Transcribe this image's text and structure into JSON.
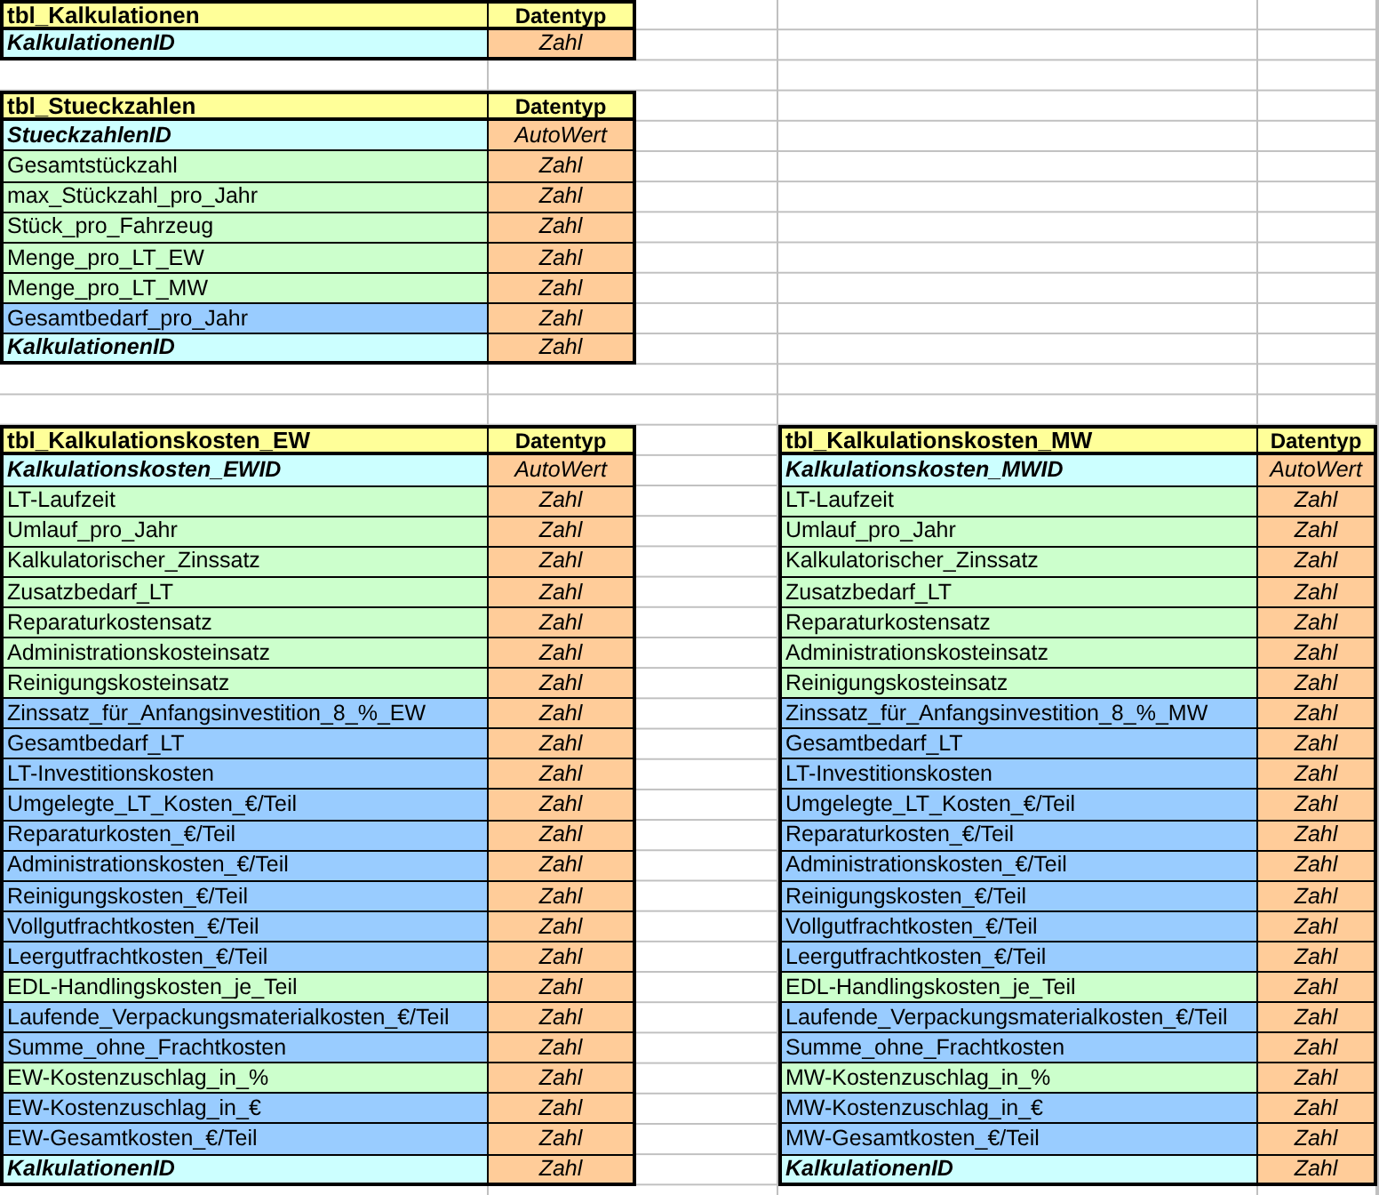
{
  "sheet": {
    "top_tables": [
      {
        "title": "tbl_Kalkulationen",
        "type_header": "Datentyp",
        "fields": [
          {
            "name": "KalkulationenID",
            "type": "Zahl",
            "kind": "key",
            "color": "#ccffff"
          }
        ]
      },
      {
        "title": "tbl_Stueckzahlen",
        "type_header": "Datentyp",
        "fields": [
          {
            "name": "StueckzahlenID",
            "type": "AutoWert",
            "kind": "key",
            "color": "#ccffff"
          },
          {
            "name": "Gesamtstückzahl",
            "type": "Zahl",
            "kind": "field",
            "color": "#ccffcc"
          },
          {
            "name": "max_Stückzahl_pro_Jahr",
            "type": "Zahl",
            "kind": "field",
            "color": "#ccffcc"
          },
          {
            "name": "Stück_pro_Fahrzeug",
            "type": "Zahl",
            "kind": "field",
            "color": "#ccffcc"
          },
          {
            "name": "Menge_pro_LT_EW",
            "type": "Zahl",
            "kind": "field",
            "color": "#ccffcc"
          },
          {
            "name": "Menge_pro_LT_MW",
            "type": "Zahl",
            "kind": "field",
            "color": "#ccffcc"
          },
          {
            "name": "Gesamtbedarf_pro_Jahr",
            "type": "Zahl",
            "kind": "field",
            "color": "#99ccff"
          },
          {
            "name": "KalkulationenID",
            "type": "Zahl",
            "kind": "key",
            "color": "#ccffff"
          }
        ]
      }
    ],
    "bottom_tables": [
      {
        "title": "tbl_Kalkulationskosten_EW",
        "type_header": "Datentyp",
        "fields": [
          {
            "name": "Kalkulationskosten_EWID",
            "type": "AutoWert",
            "kind": "key",
            "color": "#ccffff"
          },
          {
            "name": "LT-Laufzeit",
            "type": "Zahl",
            "kind": "field",
            "color": "#ccffcc"
          },
          {
            "name": "Umlauf_pro_Jahr",
            "type": "Zahl",
            "kind": "field",
            "color": "#ccffcc"
          },
          {
            "name": "Kalkulatorischer_Zinssatz",
            "type": "Zahl",
            "kind": "field",
            "color": "#ccffcc"
          },
          {
            "name": "Zusatzbedarf_LT",
            "type": "Zahl",
            "kind": "field",
            "color": "#ccffcc"
          },
          {
            "name": "Reparaturkostensatz",
            "type": "Zahl",
            "kind": "field",
            "color": "#ccffcc"
          },
          {
            "name": "Administrationskosteinsatz",
            "type": "Zahl",
            "kind": "field",
            "color": "#ccffcc"
          },
          {
            "name": "Reinigungskosteinsatz",
            "type": "Zahl",
            "kind": "field",
            "color": "#ccffcc"
          },
          {
            "name": "Zinssatz_für_Anfangsinvestition_8_%_EW",
            "type": "Zahl",
            "kind": "field",
            "color": "#99ccff"
          },
          {
            "name": "Gesamtbedarf_LT",
            "type": "Zahl",
            "kind": "field",
            "color": "#99ccff"
          },
          {
            "name": "LT-Investitionskosten",
            "type": "Zahl",
            "kind": "field",
            "color": "#99ccff"
          },
          {
            "name": "Umgelegte_LT_Kosten_€/Teil",
            "type": "Zahl",
            "kind": "field",
            "color": "#99ccff"
          },
          {
            "name": "Reparaturkosten_€/Teil",
            "type": "Zahl",
            "kind": "field",
            "color": "#99ccff"
          },
          {
            "name": "Administrationskosten_€/Teil",
            "type": "Zahl",
            "kind": "field",
            "color": "#99ccff"
          },
          {
            "name": "Reinigungskosten_€/Teil",
            "type": "Zahl",
            "kind": "field",
            "color": "#99ccff"
          },
          {
            "name": "Vollgutfrachtkosten_€/Teil",
            "type": "Zahl",
            "kind": "field",
            "color": "#99ccff"
          },
          {
            "name": "Leergutfrachtkosten_€/Teil",
            "type": "Zahl",
            "kind": "field",
            "color": "#99ccff"
          },
          {
            "name": "EDL-Handlingskosten_je_Teil",
            "type": "Zahl",
            "kind": "field",
            "color": "#ccffcc"
          },
          {
            "name": "Laufende_Verpackungsmaterialkosten_€/Teil",
            "type": "Zahl",
            "kind": "field",
            "color": "#99ccff"
          },
          {
            "name": "Summe_ohne_Frachtkosten",
            "type": "Zahl",
            "kind": "field",
            "color": "#99ccff"
          },
          {
            "name": "EW-Kostenzuschlag_in_%",
            "type": "Zahl",
            "kind": "field",
            "color": "#ccffcc"
          },
          {
            "name": "EW-Kostenzuschlag_in_€",
            "type": "Zahl",
            "kind": "field",
            "color": "#99ccff"
          },
          {
            "name": "EW-Gesamtkosten_€/Teil",
            "type": "Zahl",
            "kind": "field",
            "color": "#99ccff"
          },
          {
            "name": "KalkulationenID",
            "type": "Zahl",
            "kind": "key",
            "color": "#ccffff"
          }
        ]
      },
      {
        "title": "tbl_Kalkulationskosten_MW",
        "type_header": "Datentyp",
        "fields": [
          {
            "name": "Kalkulationskosten_MWID",
            "type": "AutoWert",
            "kind": "key",
            "color": "#ccffff"
          },
          {
            "name": "LT-Laufzeit",
            "type": "Zahl",
            "kind": "field",
            "color": "#ccffcc"
          },
          {
            "name": "Umlauf_pro_Jahr",
            "type": "Zahl",
            "kind": "field",
            "color": "#ccffcc"
          },
          {
            "name": "Kalkulatorischer_Zinssatz",
            "type": "Zahl",
            "kind": "field",
            "color": "#ccffcc"
          },
          {
            "name": "Zusatzbedarf_LT",
            "type": "Zahl",
            "kind": "field",
            "color": "#ccffcc"
          },
          {
            "name": "Reparaturkostensatz",
            "type": "Zahl",
            "kind": "field",
            "color": "#ccffcc"
          },
          {
            "name": "Administrationskosteinsatz",
            "type": "Zahl",
            "kind": "field",
            "color": "#ccffcc"
          },
          {
            "name": "Reinigungskosteinsatz",
            "type": "Zahl",
            "kind": "field",
            "color": "#ccffcc"
          },
          {
            "name": "Zinssatz_für_Anfangsinvestition_8_%_MW",
            "type": "Zahl",
            "kind": "field",
            "color": "#99ccff"
          },
          {
            "name": "Gesamtbedarf_LT",
            "type": "Zahl",
            "kind": "field",
            "color": "#99ccff"
          },
          {
            "name": "LT-Investitionskosten",
            "type": "Zahl",
            "kind": "field",
            "color": "#99ccff"
          },
          {
            "name": "Umgelegte_LT_Kosten_€/Teil",
            "type": "Zahl",
            "kind": "field",
            "color": "#99ccff"
          },
          {
            "name": "Reparaturkosten_€/Teil",
            "type": "Zahl",
            "kind": "field",
            "color": "#99ccff"
          },
          {
            "name": "Administrationskosten_€/Teil",
            "type": "Zahl",
            "kind": "field",
            "color": "#99ccff"
          },
          {
            "name": "Reinigungskosten_€/Teil",
            "type": "Zahl",
            "kind": "field",
            "color": "#99ccff"
          },
          {
            "name": "Vollgutfrachtkosten_€/Teil",
            "type": "Zahl",
            "kind": "field",
            "color": "#99ccff"
          },
          {
            "name": "Leergutfrachtkosten_€/Teil",
            "type": "Zahl",
            "kind": "field",
            "color": "#99ccff"
          },
          {
            "name": "EDL-Handlingskosten_je_Teil",
            "type": "Zahl",
            "kind": "field",
            "color": "#ccffcc"
          },
          {
            "name": "Laufende_Verpackungsmaterialkosten_€/Teil",
            "type": "Zahl",
            "kind": "field",
            "color": "#99ccff"
          },
          {
            "name": "Summe_ohne_Frachtkosten",
            "type": "Zahl",
            "kind": "field",
            "color": "#99ccff"
          },
          {
            "name": "MW-Kostenzuschlag_in_%",
            "type": "Zahl",
            "kind": "field",
            "color": "#ccffcc"
          },
          {
            "name": "MW-Kostenzuschlag_in_€",
            "type": "Zahl",
            "kind": "field",
            "color": "#99ccff"
          },
          {
            "name": "MW-Gesamtkosten_€/Teil",
            "type": "Zahl",
            "kind": "field",
            "color": "#99ccff"
          },
          {
            "name": "KalkulationenID",
            "type": "Zahl",
            "kind": "key",
            "color": "#ccffff"
          }
        ]
      }
    ]
  }
}
